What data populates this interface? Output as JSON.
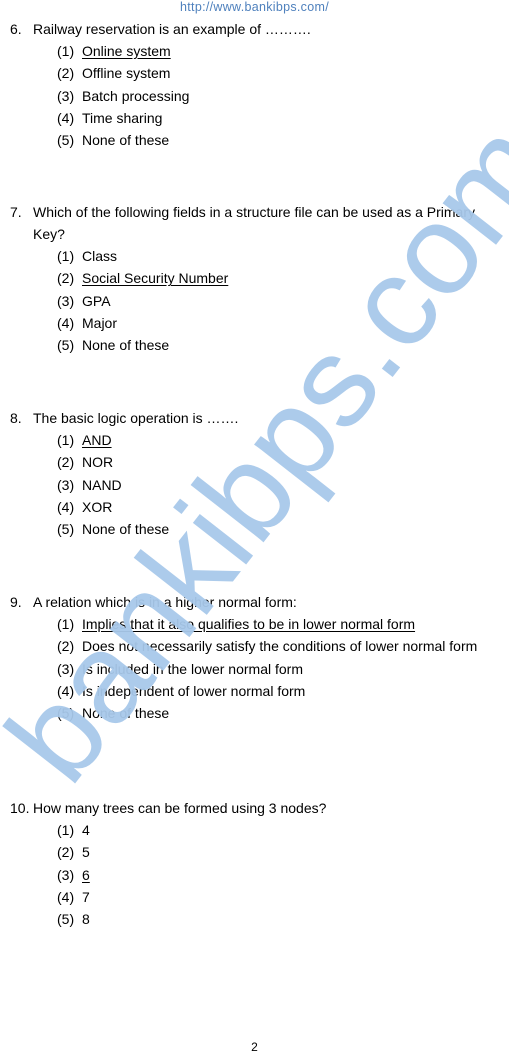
{
  "header": {
    "url": "http://www.bankibps.com/"
  },
  "watermark": {
    "text": "bankibps.com",
    "color": "#a8c8ea"
  },
  "questions": [
    {
      "number": "6.",
      "text": "Railway reservation is an example of ……….",
      "correct_option": 1,
      "options": [
        {
          "num": "(1)",
          "text": "Online system"
        },
        {
          "num": "(2)",
          "text": "Offline system"
        },
        {
          "num": "(3)",
          "text": "Batch processing"
        },
        {
          "num": "(4)",
          "text": "Time sharing"
        },
        {
          "num": "(5)",
          "text": "None of these"
        }
      ]
    },
    {
      "number": "7.",
      "text": "Which of the following fields in a structure file can be used as a Primary Key?",
      "correct_option": 2,
      "options": [
        {
          "num": "(1)",
          "text": "Class"
        },
        {
          "num": "(2)",
          "text": "Social Security Number"
        },
        {
          "num": "(3)",
          "text": "GPA"
        },
        {
          "num": "(4)",
          "text": "Major"
        },
        {
          "num": "(5)",
          "text": "None of these"
        }
      ]
    },
    {
      "number": "8.",
      "text": "The basic logic operation is …….",
      "correct_option": 1,
      "options": [
        {
          "num": "(1)",
          "text": "AND"
        },
        {
          "num": "(2)",
          "text": "NOR"
        },
        {
          "num": "(3)",
          "text": "NAND"
        },
        {
          "num": "(4)",
          "text": "XOR"
        },
        {
          "num": "(5)",
          "text": "None of these"
        }
      ]
    },
    {
      "number": "9.",
      "text": "A relation which is in a higher normal form:",
      "correct_option": 1,
      "options": [
        {
          "num": "(1)",
          "text": "Implies that it also qualifies to be in lower normal form"
        },
        {
          "num": "(2)",
          "text": "Does not necessarily satisfy the conditions of lower normal form"
        },
        {
          "num": "(3)",
          "text": "Is included in the lower normal form"
        },
        {
          "num": "(4)",
          "text": "Is independent of lower normal form"
        },
        {
          "num": "(5)",
          "text": "None of these"
        }
      ]
    },
    {
      "number": "10.",
      "text": "How many trees can be formed using 3 nodes?",
      "correct_option": 3,
      "options": [
        {
          "num": "(1)",
          "text": "4"
        },
        {
          "num": "(2)",
          "text": "5"
        },
        {
          "num": "(3)",
          "text": "6"
        },
        {
          "num": "(4)",
          "text": "7"
        },
        {
          "num": "(5)",
          "text": "8"
        }
      ]
    }
  ],
  "footer": {
    "page_number": "2"
  }
}
